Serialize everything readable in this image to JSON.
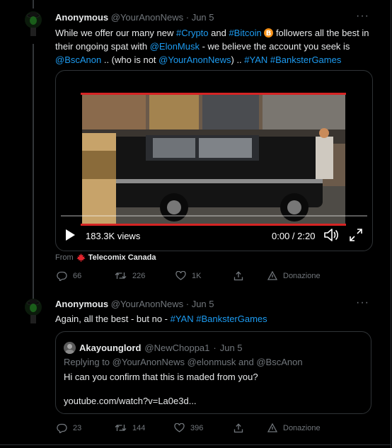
{
  "tweet1": {
    "name": "Anonymous",
    "handle": "@YourAnonNews",
    "dot": "·",
    "date": "Jun 5",
    "more": "···",
    "text": {
      "t1": "While we offer our many new ",
      "l1": "#Crypto",
      "t2": " and ",
      "l2": "#Bitcoin",
      "t3": " followers all the best in their ongoing spat with ",
      "l3": "@ElonMusk",
      "t4": " - we believe the account you seek is ",
      "l4": "@BscAnon",
      "t5": " .. (who is not ",
      "l5": "@YourAnonNews",
      "t6": ") .. ",
      "l6": "#YAN",
      "t7": " ",
      "l7": "#BanksterGames"
    },
    "video": {
      "views": "183.3K views",
      "time": "0:00 / 2:20",
      "progress": 0
    },
    "from_label": "From",
    "from_source": "Telecomix Canada",
    "replies": "66",
    "retweets": "226",
    "likes": "1K",
    "donation": "Donazione"
  },
  "tweet2": {
    "name": "Anonymous",
    "handle": "@YourAnonNews",
    "dot": "·",
    "date": "Jun 5",
    "more": "···",
    "text": {
      "t1": "Again, all the best - but no - ",
      "l1": "#YAN",
      "t2": " ",
      "l2": "#BanksterGames"
    },
    "quote": {
      "name": "Akayounglord",
      "handle": "@NewChoppa1",
      "dot": "·",
      "date": "Jun 5",
      "replying": "Replying to @YourAnonNews @elonmusk and @BscAnon",
      "text": "Hi can you confirm that this is maded from you?",
      "url": "youtube.com/watch?v=La0e3d..."
    },
    "replies": "23",
    "retweets": "144",
    "likes": "396",
    "donation": "Donazione"
  },
  "colors": {
    "background": "#000000",
    "text": "#e7e9ea",
    "muted": "#71767b",
    "link": "#1d9bf0",
    "border": "#2f3336",
    "video_accent": "#d62424",
    "bitcoin": "#f7931a"
  },
  "icons": [
    "anonymous-avatar-icon",
    "bitcoin-icon",
    "play-icon",
    "volume-icon",
    "fullscreen-icon",
    "maple-leaf-icon",
    "reply-icon",
    "retweet-icon",
    "like-icon",
    "share-icon",
    "donation-icon"
  ]
}
